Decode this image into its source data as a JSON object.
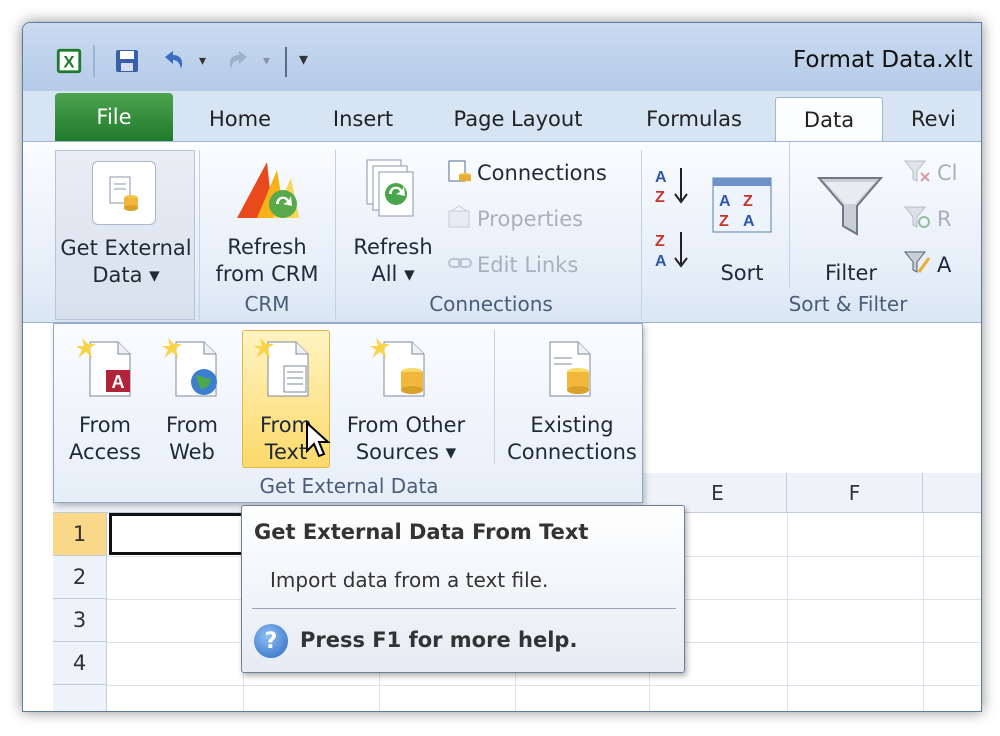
{
  "window": {
    "title": "Format Data.xlt"
  },
  "tabs": [
    {
      "label": "File"
    },
    {
      "label": "Home"
    },
    {
      "label": "Insert"
    },
    {
      "label": "Page Layout"
    },
    {
      "label": "Formulas"
    },
    {
      "label": "Data"
    },
    {
      "label": "Revi"
    }
  ],
  "ribbon": {
    "get_external": {
      "line1": "Get External",
      "line2": "Data ▾"
    },
    "crm": {
      "line1": "Refresh",
      "line2": "from CRM",
      "group": "CRM"
    },
    "connections": {
      "refresh_line1": "Refresh",
      "refresh_line2": "All ▾",
      "connections": "Connections",
      "properties": "Properties",
      "edit_links": "Edit Links",
      "group": "Connections"
    },
    "sort_filter": {
      "sort": "Sort",
      "filter": "Filter",
      "clear": "Cl",
      "reapply": "R",
      "advanced": "A",
      "group": "Sort & Filter"
    }
  },
  "dropdown": {
    "items": [
      {
        "line1": "From",
        "line2": "Access"
      },
      {
        "line1": "From",
        "line2": "Web"
      },
      {
        "line1": "From",
        "line2": "Text"
      },
      {
        "line1": "From Other",
        "line2": "Sources ▾"
      },
      {
        "line1": "Existing",
        "line2": "Connections"
      }
    ],
    "group": "Get External Data"
  },
  "sheet": {
    "columns": [
      "E",
      "F"
    ],
    "rows": [
      "1",
      "2",
      "3",
      "4"
    ]
  },
  "tooltip": {
    "title": "Get External Data From Text",
    "description": "Import data from a text file.",
    "help": "Press F1 for more help."
  },
  "colors": {
    "file_tab": "#2e8b3a",
    "active_row": "#f9d889",
    "hover": "#fcd96a"
  }
}
